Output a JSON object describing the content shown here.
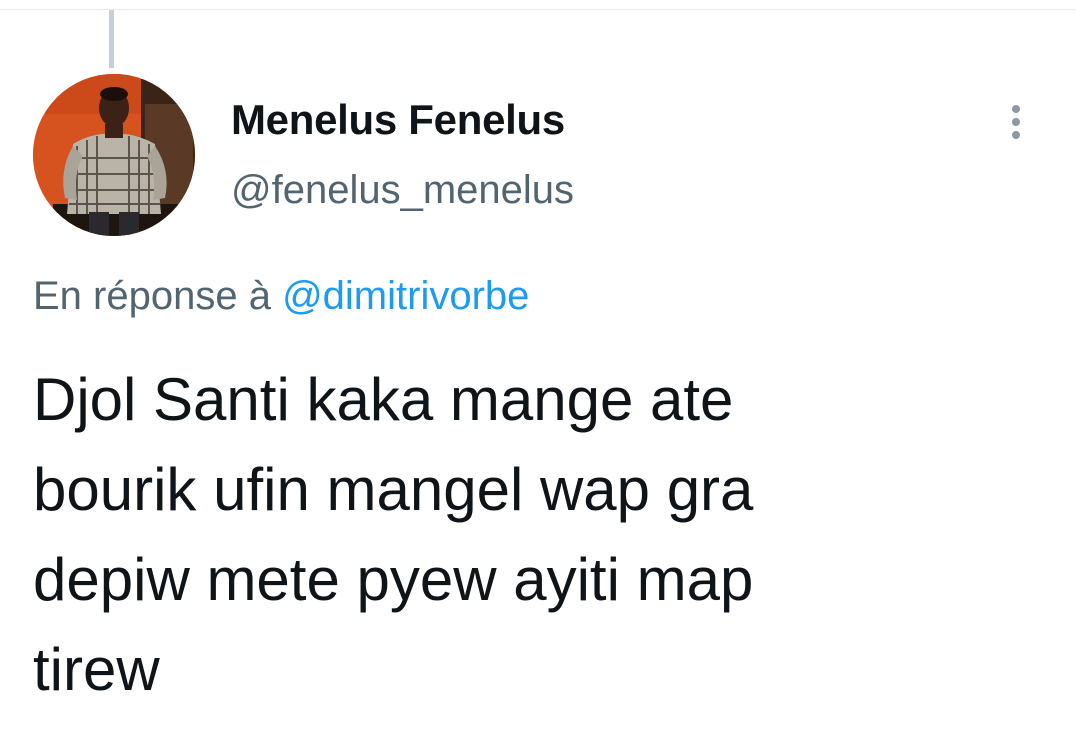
{
  "tweet": {
    "author": {
      "display_name": "Menelus Fenelus",
      "handle": "@fenelus_menelus",
      "avatar": "profile-photo"
    },
    "reply_context": {
      "prefix": "En réponse à",
      "mention": "@dimitrivorbe"
    },
    "text_lines": [
      "Djol Santi kaka mange ate",
      "bourik ufin mangel wap gra",
      "depiw mete pyew ayiti map",
      "tirew"
    ],
    "more_menu_icon": "more-vertical-icon"
  },
  "colors": {
    "text_primary": "#0f1419",
    "text_secondary": "#536471",
    "link": "#1d9bf0",
    "thread_line": "#c4cfd6"
  }
}
